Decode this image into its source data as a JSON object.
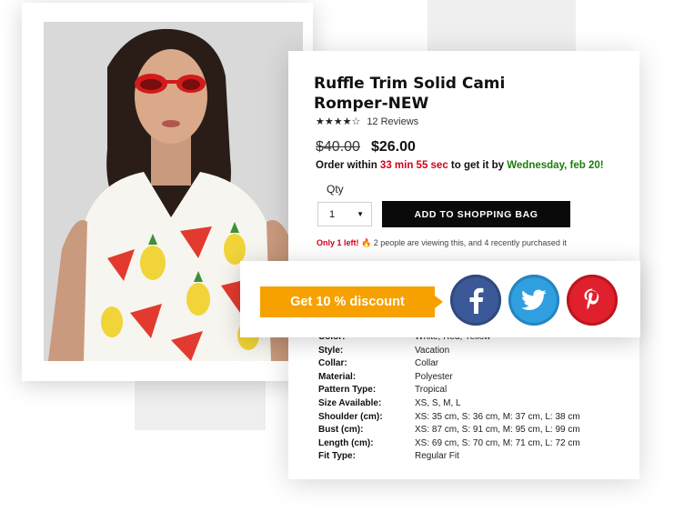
{
  "product": {
    "title_line1": "Ruffle Trim Solid Cami",
    "title_line2": "Romper-NEW",
    "stars": "★★★★☆",
    "rating_value": 4,
    "reviews": "12 Reviews",
    "old_price": "$40.00",
    "new_price": "$26.00"
  },
  "order": {
    "prefix": "Order within ",
    "timer": "33 min 55 sec",
    "middle": " to get it by ",
    "date": "Wednesday, feb 20!"
  },
  "purchase": {
    "qty_label": "Qty",
    "qty_value": "1",
    "add_button": "ADD TO SHOPPING BAG"
  },
  "stock": {
    "left": "Only 1 left!",
    "fire": "🔥",
    "text": " 2 people are viewing this, and 4 recently purchased it"
  },
  "promo": {
    "discount_label": "Get 10 % discount",
    "social": [
      "facebook-icon",
      "twitter-icon",
      "pinterest-icon"
    ]
  },
  "specs": [
    {
      "key": "Color:",
      "value": "White, Red, Yellow"
    },
    {
      "key": "Style:",
      "value": "Vacation"
    },
    {
      "key": "Collar:",
      "value": "Collar"
    },
    {
      "key": "Material:",
      "value": "Polyester"
    },
    {
      "key": "Pattern Type:",
      "value": "Tropical"
    },
    {
      "key": "Size Available:",
      "value": "XS, S, M, L"
    },
    {
      "key": "Shoulder (cm):",
      "value": "XS: 35 cm, S: 36 cm, M: 37 cm, L: 38 cm"
    },
    {
      "key": "Bust (cm):",
      "value": "XS: 87 cm, S: 91 cm, M: 95 cm, L: 99 cm"
    },
    {
      "key": "Length (cm):",
      "value": "XS: 69 cm, S: 70 cm, M: 71 cm, L: 72 cm"
    },
    {
      "key": "Fit Type:",
      "value": "Regular Fit"
    }
  ],
  "colors": {
    "accent_orange": "#f6a100",
    "sale_red": "#d0021b",
    "date_green": "#1a7d0a",
    "facebook": "#3b5998",
    "twitter": "#2f9fdf",
    "pinterest": "#e0202c"
  }
}
